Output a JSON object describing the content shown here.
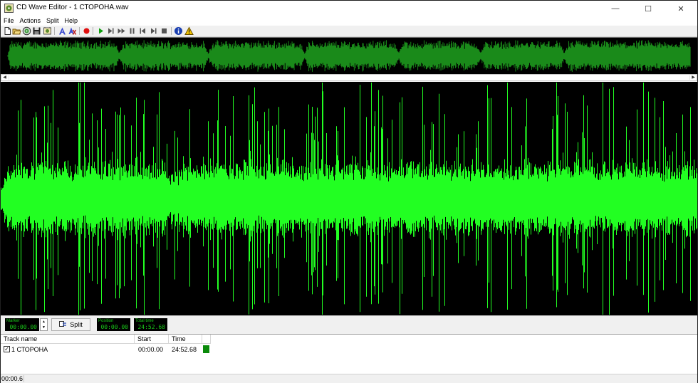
{
  "window": {
    "title": "CD Wave Editor - 1 СТОРОНА.wav",
    "controls": {
      "minimize": "—",
      "maximize": "☐",
      "close": "✕"
    }
  },
  "menu": [
    "File",
    "Actions",
    "Split",
    "Help"
  ],
  "toolbar": {
    "buttons": [
      "new-icon",
      "open-icon",
      "cd-icon",
      "save-icon",
      "settings-icon",
      "marker-icon",
      "auto-split-icon",
      "record-icon",
      "play-icon",
      "play-to-end-icon",
      "fast-forward-icon",
      "pause-icon",
      "skip-back-icon",
      "skip-forward-icon",
      "stop-icon",
      "info-icon",
      "warning-icon"
    ]
  },
  "controls": {
    "marker": {
      "label": "Marker",
      "value": "00:00.00"
    },
    "split_button": "Split",
    "position": {
      "label": "Position",
      "value": "00:00.00"
    },
    "total_time": {
      "label": "Total time",
      "value": "24:52.68"
    }
  },
  "tracklist": {
    "columns": [
      "Track name",
      "Start",
      "Time"
    ],
    "rows": [
      {
        "name": "1 СТОРОНА",
        "start": "00:00.00",
        "time": "24:52.68",
        "checked": true,
        "color": "#0a8a0a"
      }
    ]
  },
  "status": {
    "text": "00:00.6"
  },
  "colors": {
    "overview_wave": "#1a8a1a",
    "main_wave": "#22ff22",
    "wave_background": "#000000"
  }
}
